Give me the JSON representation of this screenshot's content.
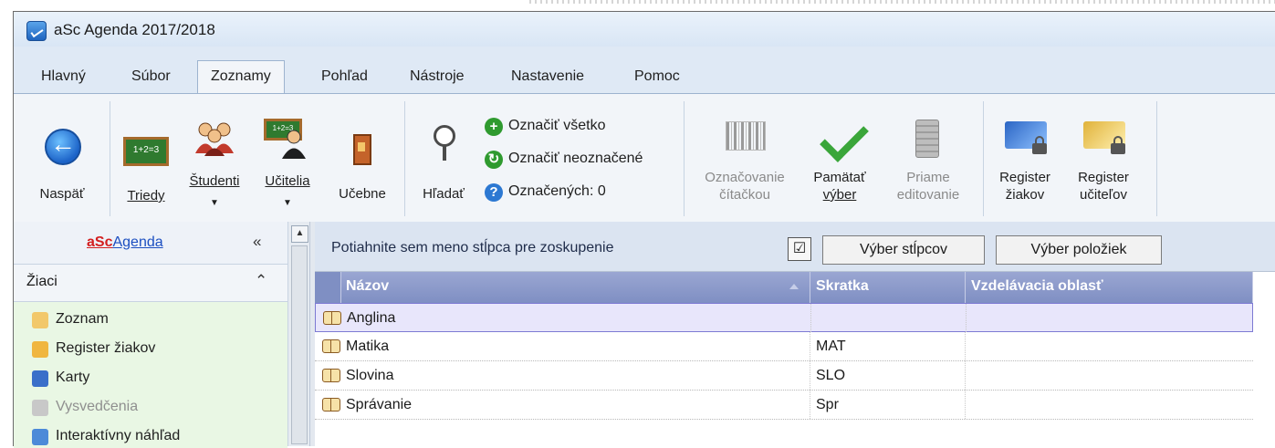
{
  "window": {
    "title": "aSc Agenda 2017/2018"
  },
  "menu": {
    "tabs": [
      "Hlavný",
      "Súbor",
      "Zoznamy",
      "Pohľad",
      "Nástroje",
      "Nastavenie",
      "Pomoc"
    ],
    "active": "Zoznamy"
  },
  "ribbon": {
    "back": "Naspäť",
    "triedy": "Triedy",
    "studenti": "Študenti",
    "ucitelia": "Učitelia",
    "ucebne": "Učebne",
    "hladat": "Hľadať",
    "oznacit_vsetko": "Označiť všetko",
    "oznacit_neoznacene": "Označiť neoznačené",
    "oznacenych": "Označených: 0",
    "oznacovanie_1": "Označovanie",
    "oznacovanie_2": "čítačkou",
    "pamatat_1": "Pamätať",
    "pamatat_2": "výber",
    "priame_1": "Priame",
    "priame_2": "editovanie",
    "reg_ziakov_1": "Register",
    "reg_ziakov_2": "žiakov",
    "reg_ucitelov_1": "Register",
    "reg_ucitelov_2": "učiteľov"
  },
  "sidebar": {
    "title_a": "aSc",
    "title_b": "Agenda",
    "collapse_glyph": "«",
    "section": "Žiaci",
    "section_glyph": "⌃",
    "items": [
      {
        "label": "Zoznam",
        "enabled": true
      },
      {
        "label": "Register žiakov",
        "enabled": true
      },
      {
        "label": "Karty",
        "enabled": true
      },
      {
        "label": "Vysvedčenia",
        "enabled": false
      },
      {
        "label": "Interaktívny náhľad",
        "enabled": true
      }
    ]
  },
  "groupbar": {
    "hint": "Potiahnite sem meno stĺpca pre zoskupenie",
    "check_glyph": "☑",
    "columns_button": "Výber stĺpcov",
    "items_button": "Výber položiek"
  },
  "grid": {
    "columns": [
      "Názov",
      "Skratka",
      "Vzdelávacia oblasť"
    ],
    "rows": [
      {
        "nazov": "Anglina",
        "skratka": "",
        "oblast": ""
      },
      {
        "nazov": "Matika",
        "skratka": "MAT",
        "oblast": ""
      },
      {
        "nazov": "Slovina",
        "skratka": "SLO",
        "oblast": ""
      },
      {
        "nazov": "Správanie",
        "skratka": "Spr",
        "oblast": ""
      }
    ],
    "selected_row": 0
  },
  "colors": {
    "accent": "#1c63c8",
    "header": "#8a98c9",
    "list_bg": "#e9f7e4",
    "selected": "#e8e6fb"
  }
}
